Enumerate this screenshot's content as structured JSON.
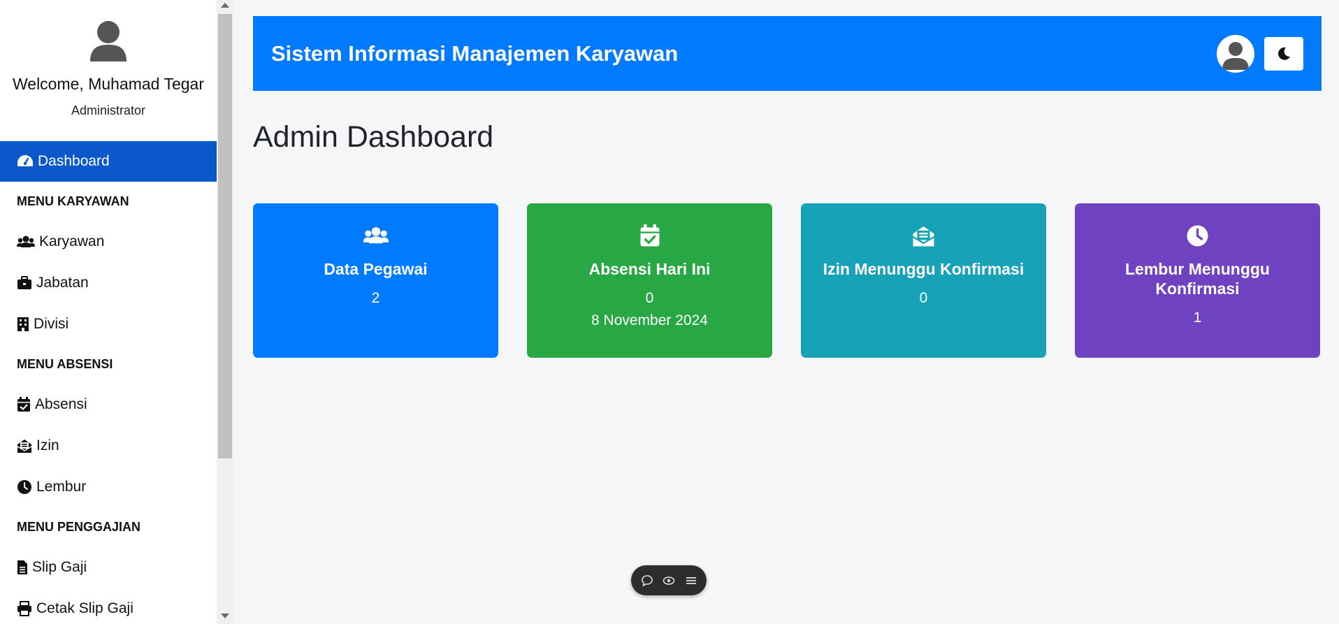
{
  "sidebar": {
    "welcome": "Welcome, Muhamad Tegar",
    "role": "Administrator",
    "active_item": "Dashboard",
    "sections": [
      {
        "title": "MENU KARYAWAN",
        "items": [
          {
            "label": "Karyawan",
            "icon": "users-icon"
          },
          {
            "label": "Jabatan",
            "icon": "briefcase-icon"
          },
          {
            "label": "Divisi",
            "icon": "building-icon"
          }
        ]
      },
      {
        "title": "MENU ABSENSI",
        "items": [
          {
            "label": "Absensi",
            "icon": "calendar-check-icon"
          },
          {
            "label": "Izin",
            "icon": "envelope-open-icon"
          },
          {
            "label": "Lembur",
            "icon": "clock-icon"
          }
        ]
      },
      {
        "title": "MENU PENGGAJIAN",
        "items": [
          {
            "label": "Slip Gaji",
            "icon": "file-icon"
          },
          {
            "label": "Cetak Slip Gaji",
            "icon": "print-icon"
          }
        ]
      }
    ]
  },
  "header": {
    "title": "Sistem Informasi Manajemen Karyawan"
  },
  "page_title": "Admin Dashboard",
  "cards": [
    {
      "title": "Data Pegawai",
      "value": "2",
      "color": "#007bff",
      "icon": "users-icon"
    },
    {
      "title": "Absensi Hari Ini",
      "value": "0",
      "sub": "8 November 2024",
      "color": "#28a745",
      "icon": "calendar-check-icon"
    },
    {
      "title": "Izin Menunggu Konfirmasi",
      "value": "0",
      "color": "#17a2b8",
      "icon": "envelope-open-icon"
    },
    {
      "title": "Lembur Menunggu Konfirmasi",
      "value": "1",
      "color": "#6f42c1",
      "icon": "clock-icon"
    }
  ],
  "colors": {
    "primary": "#007bff",
    "sidebar_active": "#0a58ca"
  }
}
